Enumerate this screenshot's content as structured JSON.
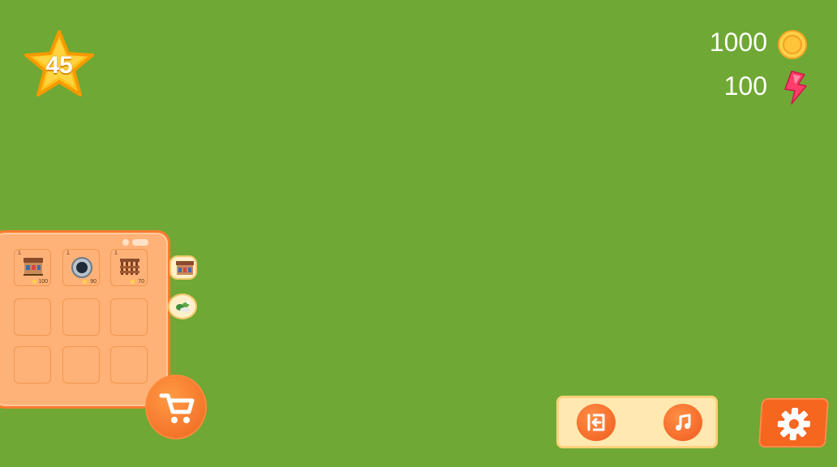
{
  "player": {
    "level": "45"
  },
  "currency": {
    "coins": "1000",
    "energy": "100",
    "coin_icon": "coin-icon",
    "energy_icon": "lightning-icon"
  },
  "inventory": {
    "slots": [
      {
        "item": "market-stall-icon",
        "count": "1",
        "price": "100"
      },
      {
        "item": "well-icon",
        "count": "1",
        "price": "90"
      },
      {
        "item": "wooden-fence-icon",
        "count": "1",
        "price": "70"
      },
      {
        "item": "",
        "count": "",
        "price": ""
      },
      {
        "item": "",
        "count": "",
        "price": ""
      },
      {
        "item": "",
        "count": "",
        "price": ""
      },
      {
        "item": "",
        "count": "",
        "price": ""
      },
      {
        "item": "",
        "count": "",
        "price": ""
      },
      {
        "item": "",
        "count": "",
        "price": ""
      }
    ],
    "categories": [
      "building-category-icon",
      "decoration-category-icon"
    ]
  },
  "buttons": {
    "shop": "cart-icon",
    "exit": "exit-icon",
    "music": "music-icon",
    "settings": "gear-icon"
  },
  "colors": {
    "background": "#6fa834",
    "panel": "#ffb277",
    "accent": "#f5661f",
    "star": "#ffc21a"
  }
}
